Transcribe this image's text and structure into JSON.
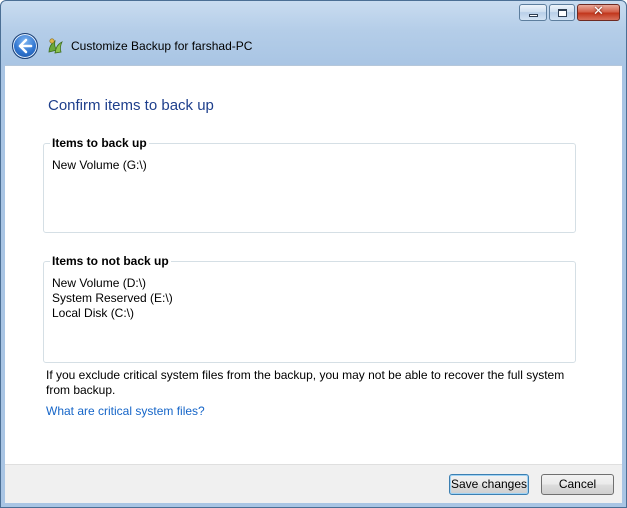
{
  "window": {
    "title": "Customize Backup for farshad-PC",
    "controls": {
      "minimize": "minimize-icon",
      "maximize": "maximize-icon",
      "close": "close-icon"
    }
  },
  "page": {
    "heading": "Confirm items to back up"
  },
  "backup_group": {
    "legend": "Items to back up",
    "items": [
      "New Volume (G:\\)"
    ]
  },
  "exclude_group": {
    "legend": "Items to not back up",
    "items": [
      "New Volume (D:\\)",
      "System Reserved (E:\\)",
      "Local Disk (C:\\)"
    ]
  },
  "warning": "If you exclude critical system files from the backup, you may not be able to recover the full system from backup.",
  "help_link": "What are critical system files?",
  "buttons": {
    "save": "Save changes",
    "cancel": "Cancel"
  },
  "colors": {
    "heading": "#1e3f8c",
    "link": "#1565c8",
    "frame": "#a9c5e4"
  }
}
